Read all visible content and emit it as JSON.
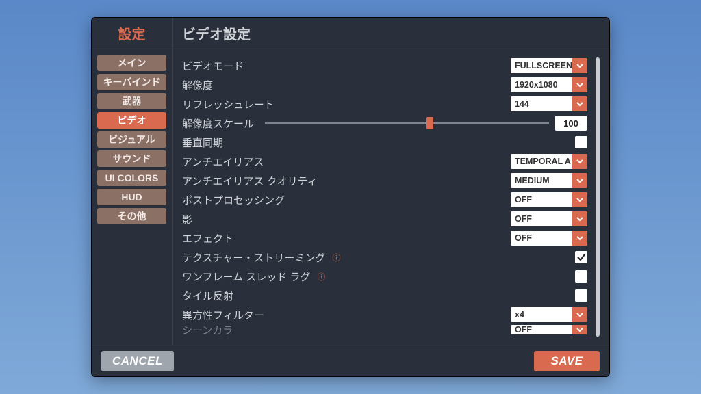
{
  "titlebar": {
    "settings": "設定",
    "page_title": "ビデオ設定"
  },
  "sidebar": {
    "items": [
      {
        "label": "メイン",
        "active": false
      },
      {
        "label": "キーバインド",
        "active": false
      },
      {
        "label": "武器",
        "active": false
      },
      {
        "label": "ビデオ",
        "active": true
      },
      {
        "label": "ビジュアル",
        "active": false
      },
      {
        "label": "サウンド",
        "active": false
      },
      {
        "label": "UI COLORS",
        "active": false
      },
      {
        "label": "HUD",
        "active": false
      },
      {
        "label": "その他",
        "active": false
      }
    ]
  },
  "rows": {
    "video_mode": {
      "label": "ビデオモード",
      "value": "FULLSCREEN"
    },
    "resolution": {
      "label": "解像度",
      "value": "1920x1080"
    },
    "refresh": {
      "label": "リフレッシュレート",
      "value": "144"
    },
    "res_scale": {
      "label": "解像度スケール",
      "value": "100",
      "percent": 58
    },
    "vsync": {
      "label": "垂直同期",
      "checked": false
    },
    "aa": {
      "label": "アンチエイリアス",
      "value": "TEMPORAL A"
    },
    "aa_quality": {
      "label": "アンチエイリアス クオリティ",
      "value": "MEDIUM"
    },
    "post": {
      "label": "ポストプロセッシング",
      "value": "OFF"
    },
    "shadows": {
      "label": "影",
      "value": "OFF"
    },
    "effects": {
      "label": "エフェクト",
      "value": "OFF"
    },
    "tex_stream": {
      "label": "テクスチャー・ストリーミング",
      "checked": true,
      "help": true
    },
    "one_frame": {
      "label": "ワンフレーム スレッド ラグ",
      "checked": false,
      "help": true
    },
    "tile_refl": {
      "label": "タイル反射",
      "checked": false
    },
    "aniso": {
      "label": "異方性フィルター",
      "value": "x4"
    },
    "cut": {
      "label": "シーンカラ",
      "value": "OFF"
    }
  },
  "footer": {
    "cancel": "CANCEL",
    "save": "SAVE"
  }
}
